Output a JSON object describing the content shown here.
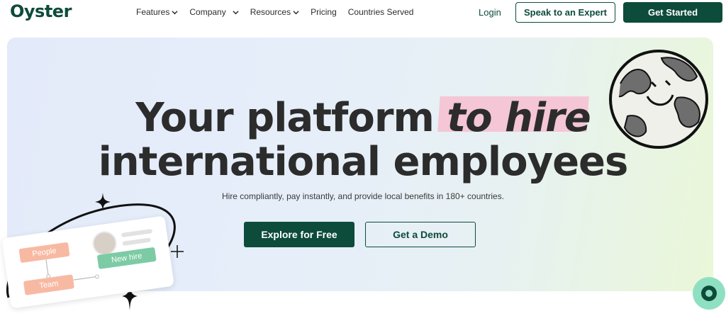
{
  "brand": {
    "logo_text": "Oyster",
    "accent": "#0d4b3b",
    "highlight": "#f4c6d6"
  },
  "nav": {
    "items": [
      {
        "label": "Features",
        "has_dropdown": true
      },
      {
        "label": "Company",
        "has_dropdown": true
      },
      {
        "label": "Resources",
        "has_dropdown": true
      },
      {
        "label": "Pricing",
        "has_dropdown": false
      },
      {
        "label": "Countries Served",
        "has_dropdown": false
      }
    ],
    "login": "Login",
    "expert_button": "Speak to an Expert",
    "start_button": "Get Started"
  },
  "hero": {
    "headline_part1": "Your platform ",
    "headline_highlight": "to hire",
    "headline_line2": "international employees",
    "subtitle": "Hire compliantly, pay instantly, and provide local benefits in 180+ countries.",
    "explore_button": "Explore for Free",
    "demo_button": "Get a Demo"
  },
  "card": {
    "people": "People",
    "team": "Team",
    "new_hire": "New hire"
  },
  "icons": {
    "chat": "chat-bubble-icon",
    "globe": "globe-face-icon",
    "sparkle": "sparkle-icon"
  }
}
